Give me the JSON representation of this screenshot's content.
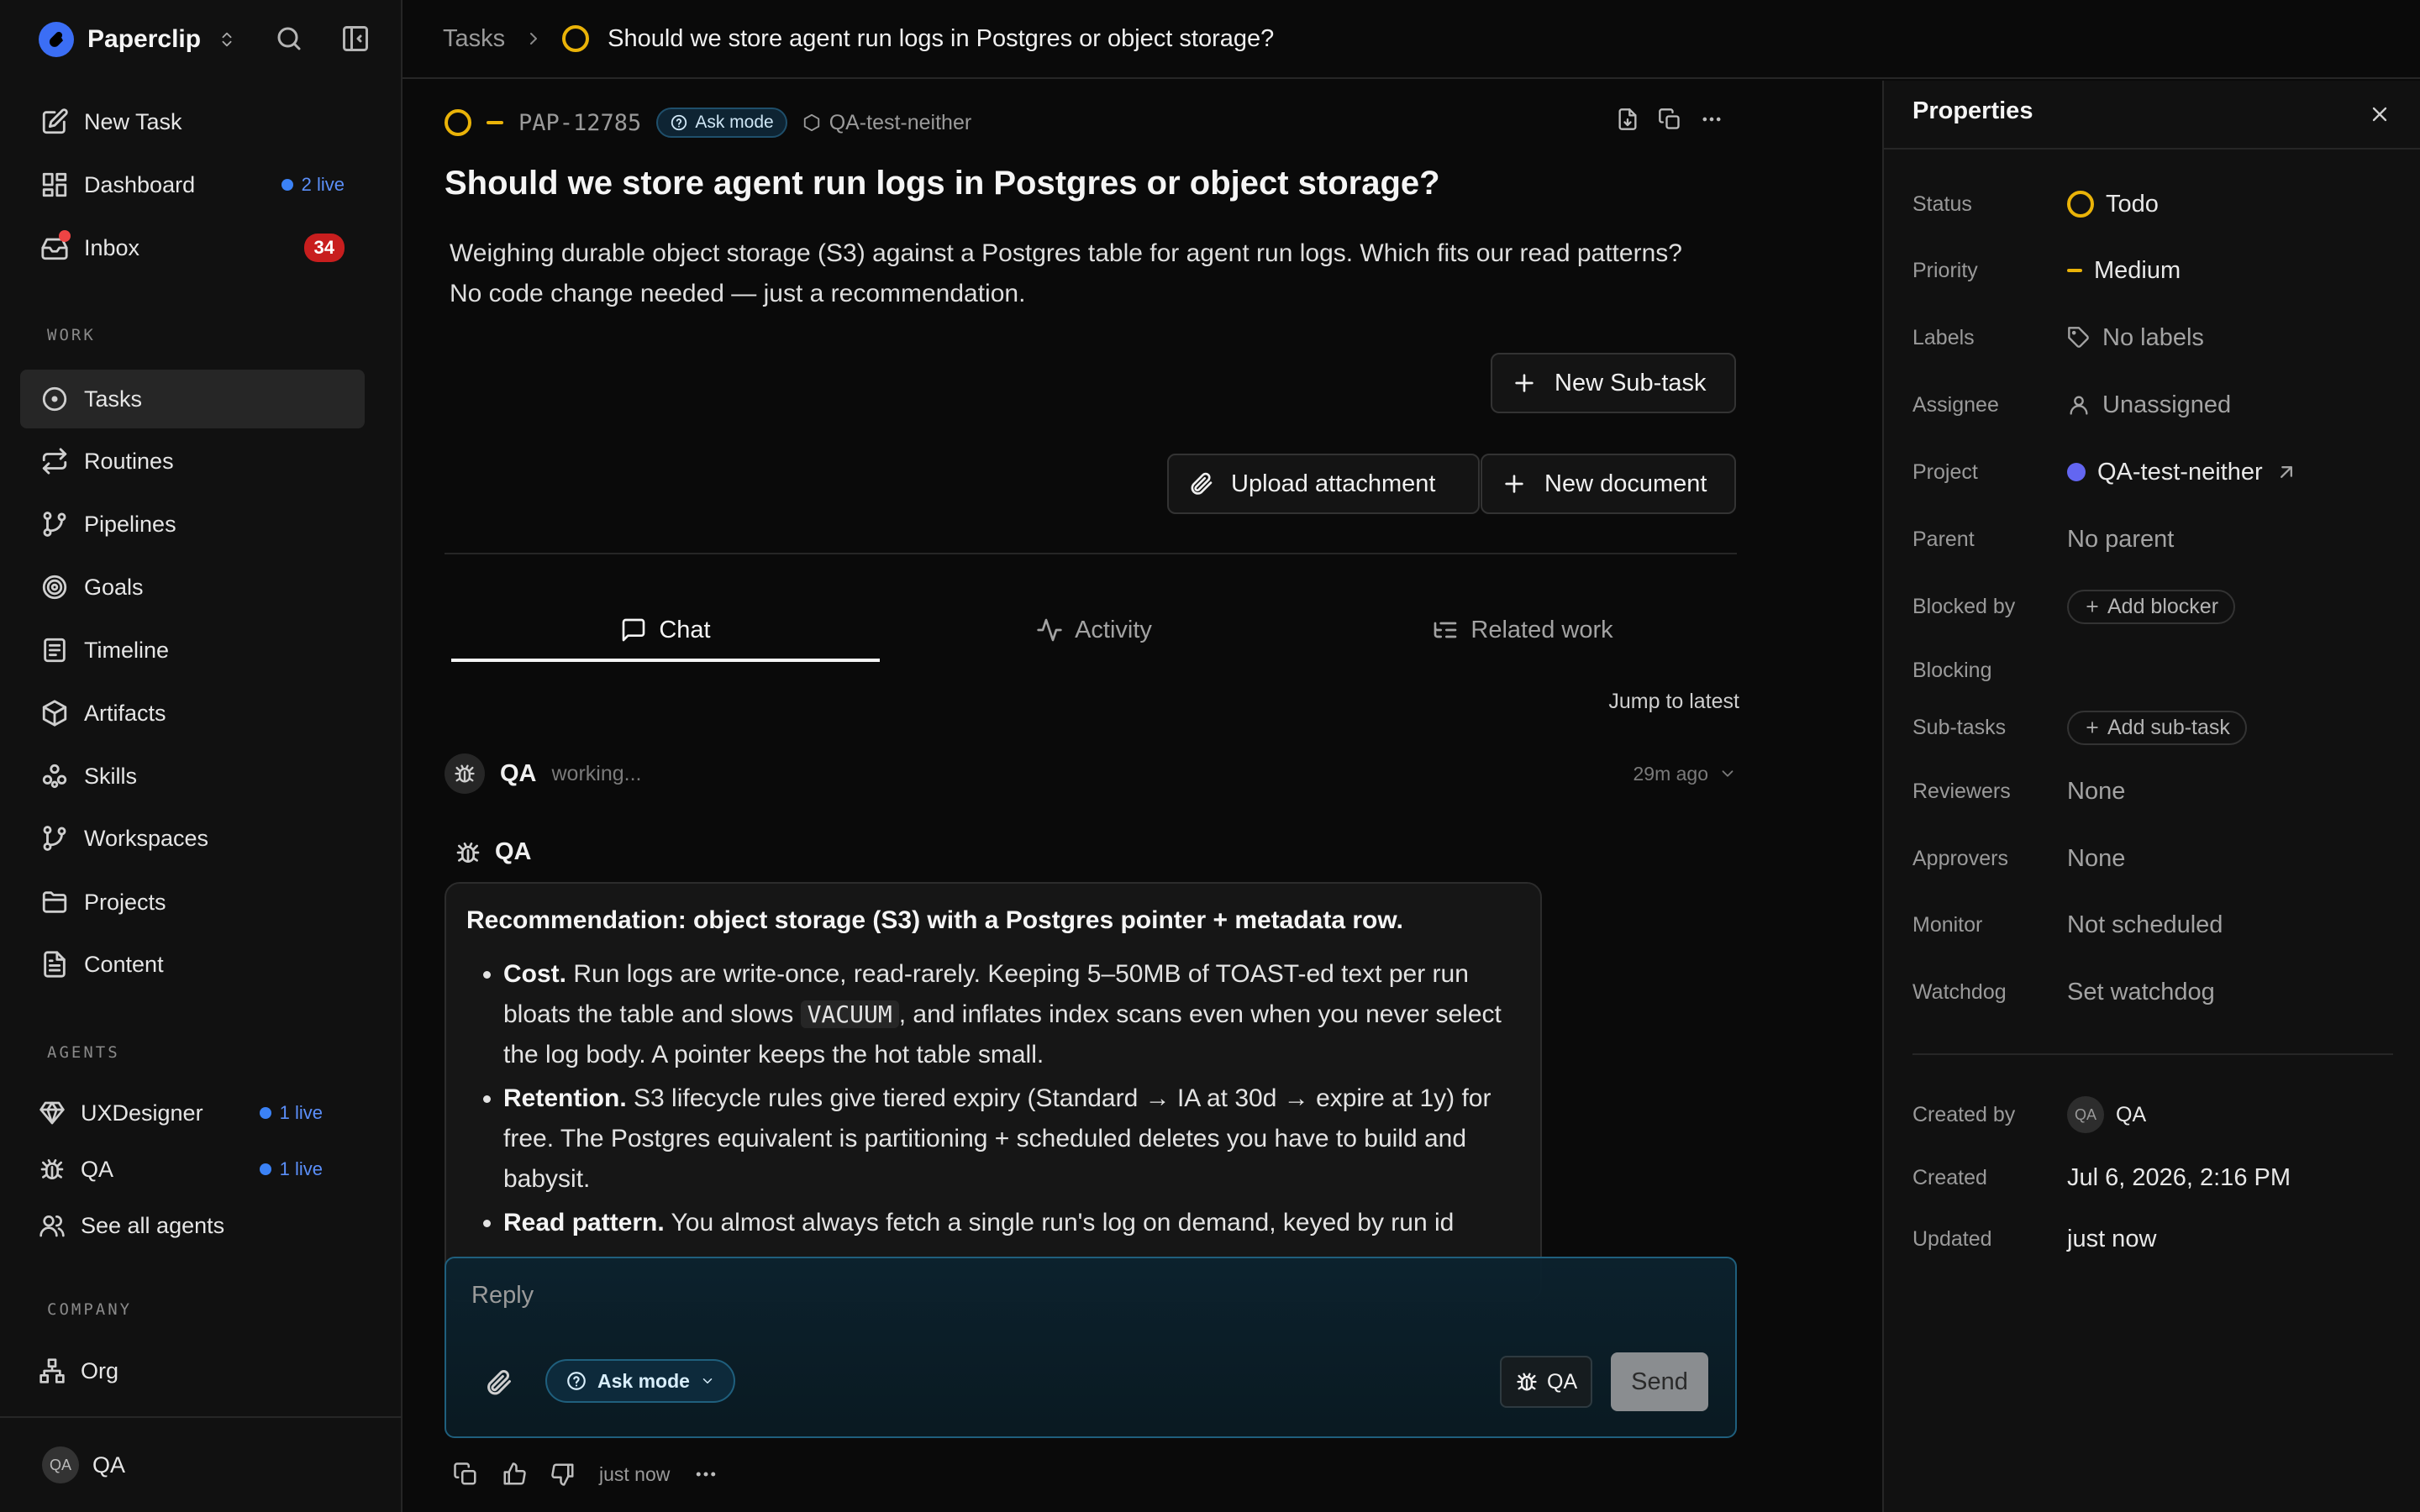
{
  "sidebar": {
    "brand": "Paperclip",
    "nav": [
      {
        "label": "New Task",
        "icon": "edit-icon"
      },
      {
        "label": "Dashboard",
        "icon": "dashboard-icon",
        "live": "2 live"
      },
      {
        "label": "Inbox",
        "icon": "inbox-icon",
        "badge": "34"
      }
    ],
    "work_heading": "WORK",
    "work": [
      {
        "label": "Tasks",
        "icon": "circle-dot-icon",
        "active": true
      },
      {
        "label": "Routines",
        "icon": "repeat-icon"
      },
      {
        "label": "Pipelines",
        "icon": "git-branch-icon"
      },
      {
        "label": "Goals",
        "icon": "target-icon"
      },
      {
        "label": "Timeline",
        "icon": "timeline-icon"
      },
      {
        "label": "Artifacts",
        "icon": "package-icon"
      },
      {
        "label": "Skills",
        "icon": "skills-icon"
      },
      {
        "label": "Workspaces",
        "icon": "git-branch-icon"
      },
      {
        "label": "Projects",
        "icon": "folder-icon"
      },
      {
        "label": "Content",
        "icon": "file-text-icon"
      }
    ],
    "agents_heading": "AGENTS",
    "agents": [
      {
        "label": "UXDesigner",
        "icon": "gem-icon",
        "live": "1 live"
      },
      {
        "label": "QA",
        "icon": "bug-icon",
        "live": "1 live"
      }
    ],
    "see_all_agents": "See all agents",
    "company_heading": "COMPANY",
    "company": [
      {
        "label": "Org",
        "icon": "org-icon"
      }
    ],
    "user": {
      "initials": "QA",
      "name": "QA"
    }
  },
  "topbar": {
    "crumb_root": "Tasks",
    "crumb_title": "Should we store agent run logs in Postgres or object storage?"
  },
  "task": {
    "id": "PAP-12785",
    "mode": "Ask mode",
    "project": "QA-test-neither",
    "title": "Should we store agent run logs in Postgres or object storage?",
    "description": "Weighing durable object storage (S3) against a Postgres table for agent run logs. Which fits our read patterns? No code change needed — just a recommendation.",
    "new_subtask": "New Sub-task",
    "upload_attachment": "Upload attachment",
    "new_document": "New document",
    "colors": {
      "status": "#eab308",
      "accent": "#3b82f6",
      "badge": "#c81e1e"
    }
  },
  "tabs": [
    {
      "label": "Chat",
      "icon": "chat-icon"
    },
    {
      "label": "Activity",
      "icon": "activity-icon"
    },
    {
      "label": "Related work",
      "icon": "list-tree-icon"
    }
  ],
  "chat": {
    "jump_to_latest": "Jump to latest",
    "agent_name": "QA",
    "agent_status": "working...",
    "time_ago": "29m ago",
    "message": {
      "author": "QA",
      "lead": "Recommendation: object storage (S3) with a Postgres pointer + metadata row.",
      "bullets": [
        {
          "head": "Cost.",
          "text_a": "Run logs are write-once, read-rarely. Keeping 5–50MB of TOAST-ed text per run bloats the table and slows",
          "code": "VACUUM",
          "text_b": ", and inflates index scans even when you never select the log body. A pointer keeps the hot table small."
        },
        {
          "head": "Retention.",
          "text": "S3 lifecycle rules give tiered expiry (Standard → IA at 30d → expire at 1y) for free. The Postgres equivalent is partitioning + scheduled deletes you have to build and babysit."
        },
        {
          "head": "Read pattern.",
          "text": "You almost always fetch a single run's log on demand, keyed by run id"
        }
      ]
    },
    "composer": {
      "placeholder": "Reply",
      "mode": "Ask mode",
      "agent": "QA",
      "send": "Send"
    },
    "footer_time": "just now"
  },
  "properties": {
    "title": "Properties",
    "status": {
      "label": "Status",
      "value": "Todo"
    },
    "priority": {
      "label": "Priority",
      "value": "Medium"
    },
    "labels": {
      "label": "Labels",
      "value": "No labels"
    },
    "assignee": {
      "label": "Assignee",
      "value": "Unassigned"
    },
    "project": {
      "label": "Project",
      "value": "QA-test-neither",
      "color": "#6366f1"
    },
    "parent": {
      "label": "Parent",
      "value": "No parent"
    },
    "blocked_by": {
      "label": "Blocked by",
      "value": "Add blocker"
    },
    "blocking": {
      "label": "Blocking"
    },
    "subtasks": {
      "label": "Sub-tasks",
      "value": "Add sub-task"
    },
    "reviewers": {
      "label": "Reviewers",
      "value": "None"
    },
    "approvers": {
      "label": "Approvers",
      "value": "None"
    },
    "monitor": {
      "label": "Monitor",
      "value": "Not scheduled"
    },
    "watchdog": {
      "label": "Watchdog",
      "value": "Set watchdog"
    },
    "created_by": {
      "label": "Created by",
      "initials": "QA",
      "value": "QA"
    },
    "created": {
      "label": "Created",
      "value": "Jul 6, 2026, 2:16 PM"
    },
    "updated": {
      "label": "Updated",
      "value": "just now"
    }
  }
}
